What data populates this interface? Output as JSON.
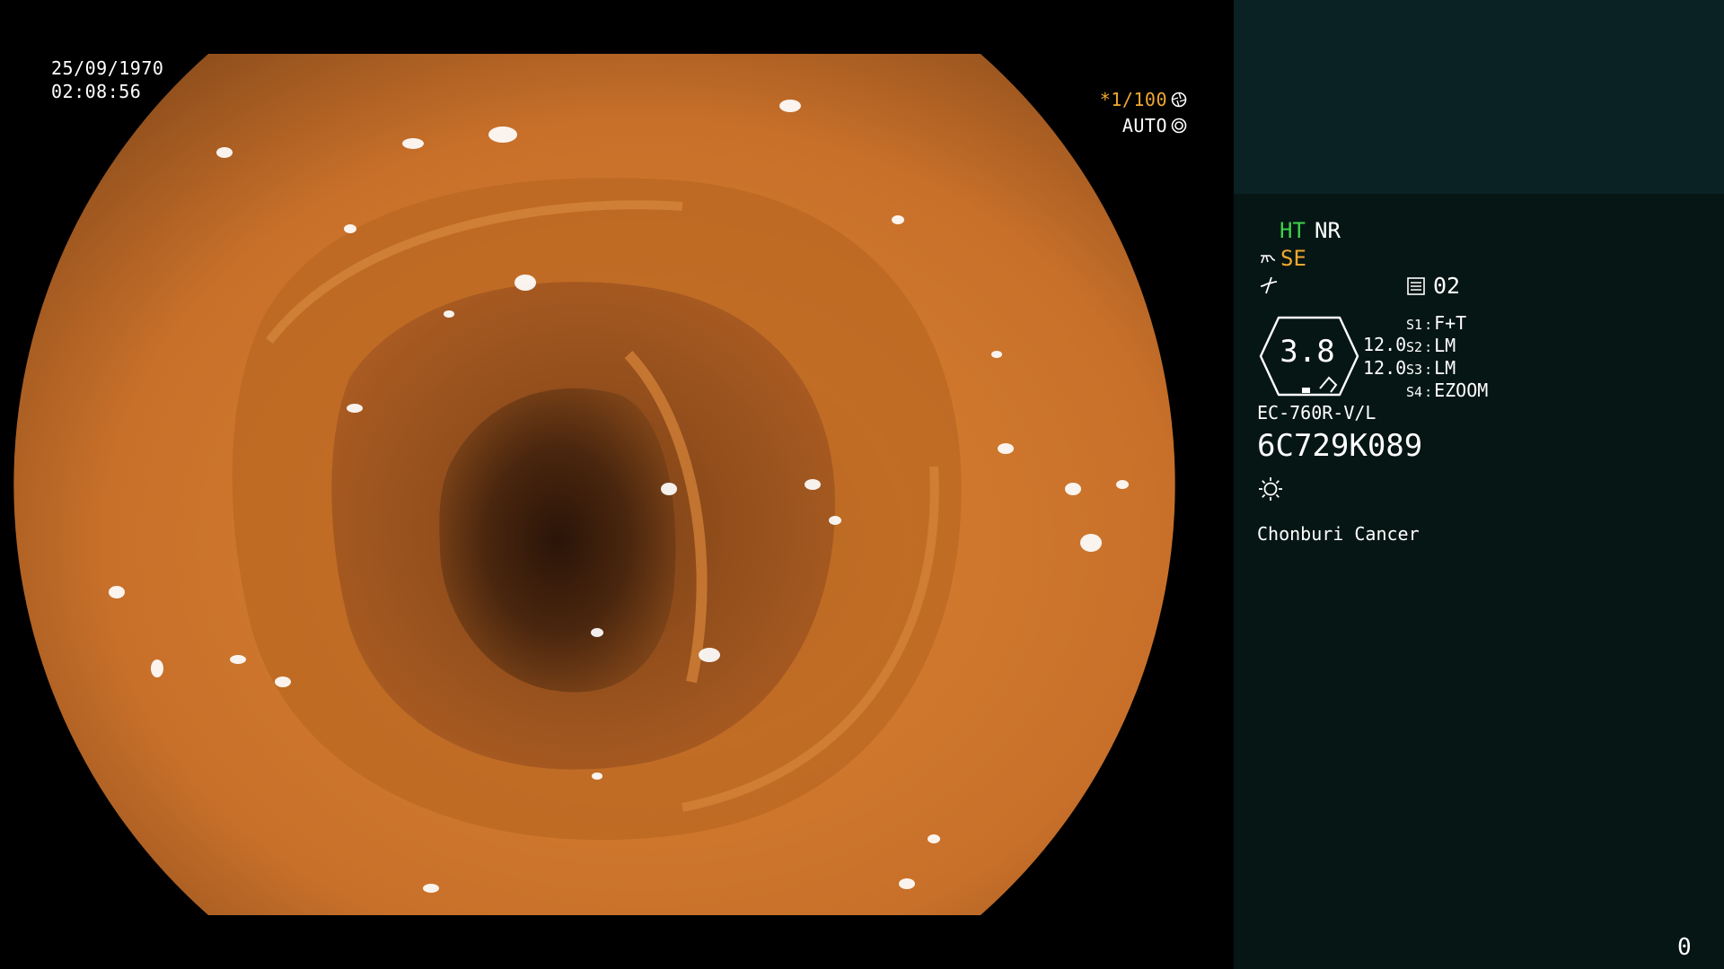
{
  "osd": {
    "date": "25/09/1970",
    "time": "02:08:56",
    "shutter": "*1/100",
    "iris": "AUTO",
    "shutter_color": "#f0a830",
    "icons": {
      "shutter": "shutter-icon",
      "iris": "iris-icon"
    }
  },
  "panel": {
    "mode_ht": "HT",
    "mode_nr": "NR",
    "mode_se": "SE",
    "ht_color": "#3fd04a",
    "se_color": "#f0a830",
    "memo_number": "02",
    "zoom": "3.8",
    "value_a": "12.0",
    "value_b": "12.0",
    "switches": [
      {
        "key": "S1",
        "value": "F+T"
      },
      {
        "key": "S2",
        "value": "LM"
      },
      {
        "key": "S3",
        "value": "LM"
      },
      {
        "key": "S4",
        "value": "EZOOM"
      }
    ],
    "scope_model": "EC-760R-V/L",
    "scope_serial": "6C729K089",
    "hospital": "Chonburi Cancer",
    "counter": "0",
    "icons": {
      "structure": "scope-structure-icon",
      "enhance": "enhance-icon",
      "memo": "memo-card-icon",
      "light": "light-source-icon"
    }
  }
}
